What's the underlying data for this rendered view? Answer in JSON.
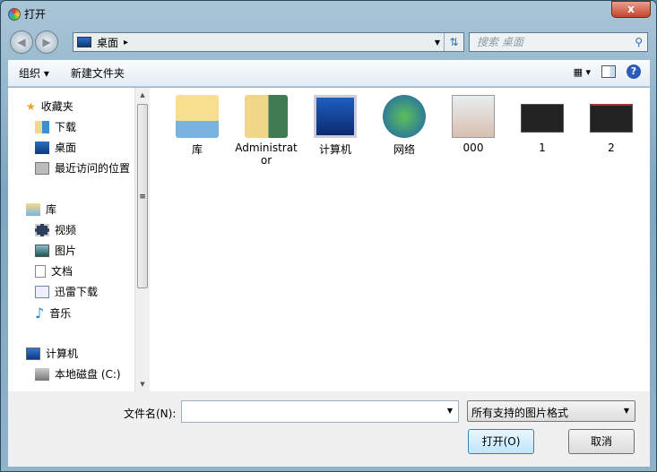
{
  "window": {
    "title": "打开",
    "close": "x"
  },
  "address": {
    "location": "桌面",
    "arrow": "▸"
  },
  "search": {
    "placeholder": "搜索 桌面"
  },
  "toolbar": {
    "organize": "组织 ▾",
    "new_folder": "新建文件夹"
  },
  "sidebar": {
    "favorites": "收藏夹",
    "downloads": "下载",
    "desktop": "桌面",
    "recent": "最近访问的位置",
    "libraries": "库",
    "videos": "视频",
    "pictures": "图片",
    "documents": "文档",
    "xunlei": "迅雷下载",
    "music": "音乐",
    "computer": "计算机",
    "local_disk": "本地磁盘 (C:)"
  },
  "items": [
    "库",
    "Administrator",
    "计算机",
    "网络",
    "000",
    "1",
    "2"
  ],
  "bottom": {
    "filename_label": "文件名(N):",
    "filename_value": "",
    "filetype": "所有支持的图片格式",
    "open": "打开(O)",
    "cancel": "取消"
  }
}
